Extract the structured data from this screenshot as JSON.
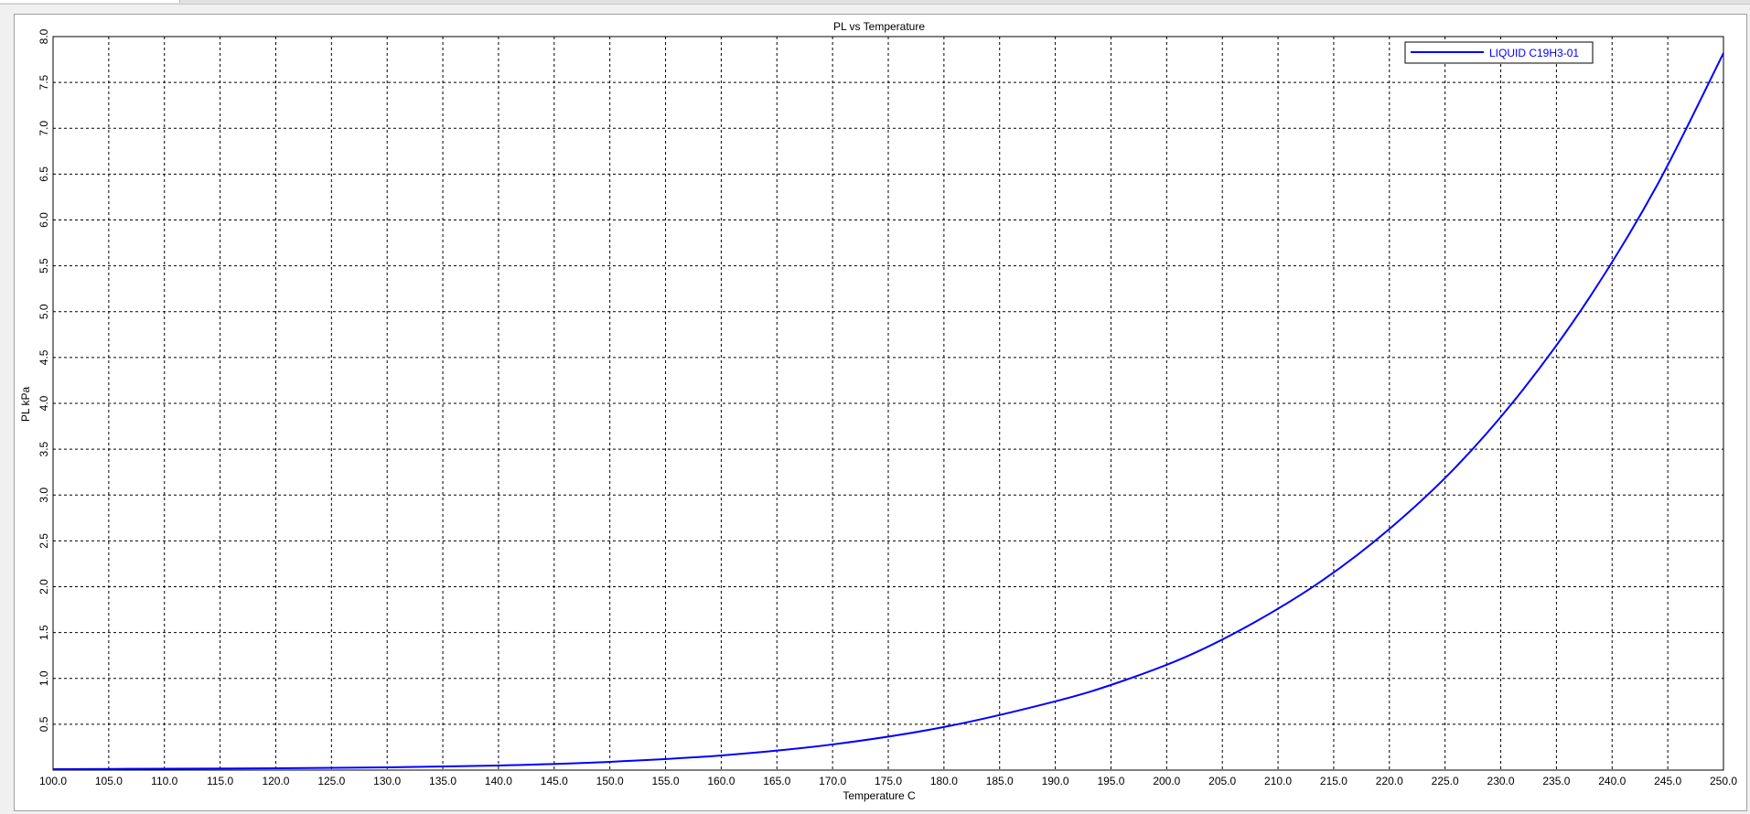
{
  "chart_data": {
    "type": "line",
    "title": "PL vs Temperature",
    "xlabel": "Temperature  C",
    "ylabel": "PL kPa",
    "xlim": [
      100,
      250
    ],
    "ylim": [
      0,
      8
    ],
    "x_ticks": [
      "100.0",
      "105.0",
      "110.0",
      "115.0",
      "120.0",
      "125.0",
      "130.0",
      "135.0",
      "140.0",
      "145.0",
      "150.0",
      "155.0",
      "160.0",
      "165.0",
      "170.0",
      "175.0",
      "180.0",
      "185.0",
      "190.0",
      "195.0",
      "200.0",
      "205.0",
      "210.0",
      "215.0",
      "220.0",
      "225.0",
      "230.0",
      "235.0",
      "240.0",
      "245.0",
      "250.0"
    ],
    "y_ticks": [
      "0.5",
      "1.0",
      "1.5",
      "2.0",
      "2.5",
      "3.0",
      "3.5",
      "4.0",
      "4.5",
      "5.0",
      "5.5",
      "6.0",
      "6.5",
      "7.0",
      "7.5",
      "8.0"
    ],
    "grid": true,
    "legend_position": "top-right",
    "series": [
      {
        "name": "LIQUID C19H3-01",
        "color": "#0000ff",
        "x": [
          100,
          110,
          120,
          130,
          140,
          150,
          160,
          170,
          180,
          190,
          196,
          202,
          208,
          214,
          220,
          226,
          232,
          238,
          244,
          250
        ],
        "y": [
          0.01,
          0.015,
          0.02,
          0.03,
          0.05,
          0.09,
          0.16,
          0.28,
          0.47,
          0.75,
          0.97,
          1.25,
          1.62,
          2.07,
          2.63,
          3.31,
          4.15,
          5.16,
          6.37,
          7.82
        ]
      }
    ]
  }
}
